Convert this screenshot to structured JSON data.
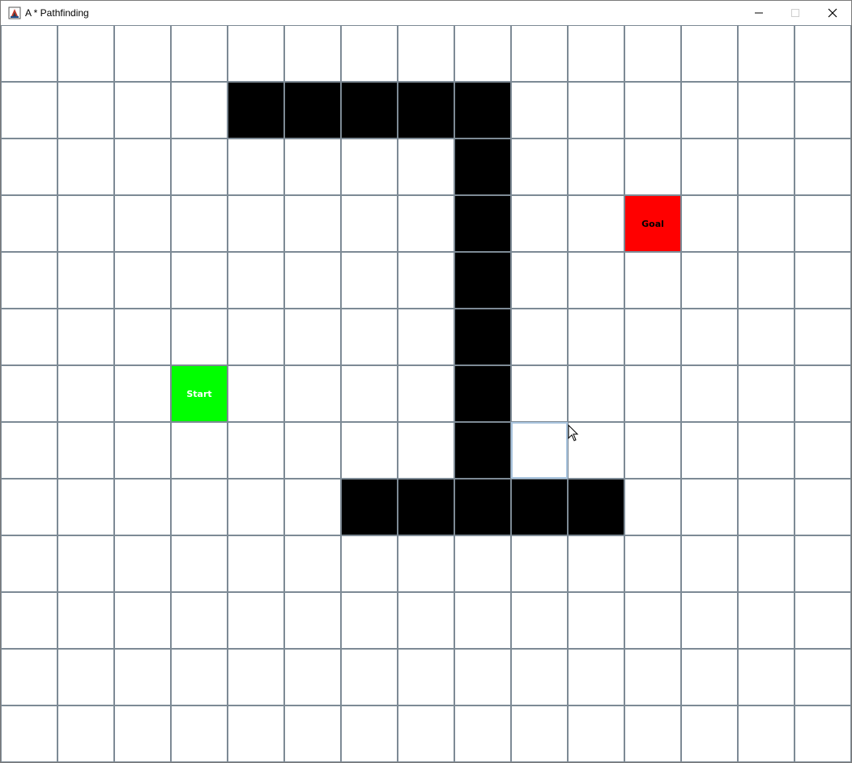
{
  "window": {
    "title": "A * Pathfinding",
    "icon": "java-cup-icon",
    "controls": [
      "minimize-icon",
      "maximize-icon",
      "close-icon"
    ]
  },
  "grid": {
    "columns": 15,
    "rows": 13,
    "colors": {
      "empty": "#ffffff",
      "wall": "#000000",
      "start": "#00ff00",
      "goal": "#ff0000",
      "gridline": "#7d8a95",
      "hover_border": "#a9c4de"
    },
    "start": {
      "row": 6,
      "col": 3,
      "label": "Start"
    },
    "goal": {
      "row": 3,
      "col": 11,
      "label": "Goal"
    },
    "hover_cell": {
      "row": 7,
      "col": 9
    },
    "walls": [
      [
        1,
        4
      ],
      [
        1,
        5
      ],
      [
        1,
        6
      ],
      [
        1,
        7
      ],
      [
        1,
        8
      ],
      [
        2,
        8
      ],
      [
        3,
        8
      ],
      [
        4,
        8
      ],
      [
        5,
        8
      ],
      [
        6,
        8
      ],
      [
        7,
        8
      ],
      [
        8,
        6
      ],
      [
        8,
        7
      ],
      [
        8,
        8
      ],
      [
        8,
        9
      ],
      [
        8,
        10
      ]
    ]
  }
}
